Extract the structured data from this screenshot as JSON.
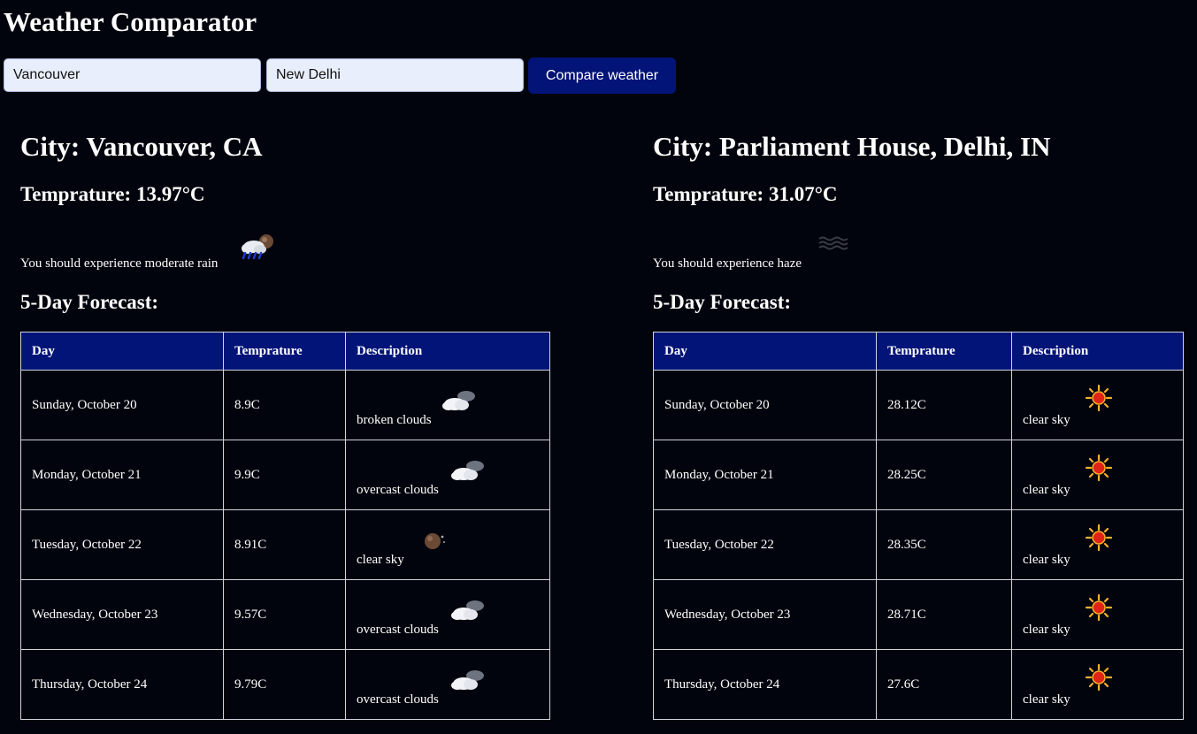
{
  "app": {
    "title": "Weather Comparator"
  },
  "search": {
    "city1_value": "Vancouver",
    "city2_value": "New Delhi",
    "compare_label": "Compare weather"
  },
  "columns": {
    "day": "Day",
    "temp": "Temprature",
    "desc": "Description"
  },
  "left": {
    "city": "City: Vancouver, CA",
    "temperature": "Temprature: 13.97°C",
    "experience": "You should experience moderate rain",
    "experience_icon": "rain-cloud-moon-icon",
    "forecast_heading": "5-Day Forecast:",
    "forecast": [
      {
        "day": "Sunday, October 20",
        "temp": "8.9C",
        "desc": "broken clouds",
        "icon": "cloud-night-icon"
      },
      {
        "day": "Monday, October 21",
        "temp": "9.9C",
        "desc": "overcast clouds",
        "icon": "cloud-night-icon"
      },
      {
        "day": "Tuesday, October 22",
        "temp": "8.91C",
        "desc": "clear sky",
        "icon": "moon-icon"
      },
      {
        "day": "Wednesday, October 23",
        "temp": "9.57C",
        "desc": "overcast clouds",
        "icon": "cloud-night-icon"
      },
      {
        "day": "Thursday, October 24",
        "temp": "9.79C",
        "desc": "overcast clouds",
        "icon": "cloud-night-icon"
      }
    ]
  },
  "right": {
    "city": "City: Parliament House, Delhi, IN",
    "temperature": "Temprature: 31.07°C",
    "experience": "You should experience haze",
    "experience_icon": "haze-icon",
    "forecast_heading": "5-Day Forecast:",
    "forecast": [
      {
        "day": "Sunday, October 20",
        "temp": "28.12C",
        "desc": "clear sky",
        "icon": "sun-icon"
      },
      {
        "day": "Monday, October 21",
        "temp": "28.25C",
        "desc": "clear sky",
        "icon": "sun-icon"
      },
      {
        "day": "Tuesday, October 22",
        "temp": "28.35C",
        "desc": "clear sky",
        "icon": "sun-icon"
      },
      {
        "day": "Wednesday, October 23",
        "temp": "28.71C",
        "desc": "clear sky",
        "icon": "sun-icon"
      },
      {
        "day": "Thursday, October 24",
        "temp": "27.6C",
        "desc": "clear sky",
        "icon": "sun-icon"
      }
    ]
  },
  "colors": {
    "background": "#02040d",
    "accent": "#031478",
    "text": "#ffffff",
    "input_bg": "#e8eefb"
  }
}
